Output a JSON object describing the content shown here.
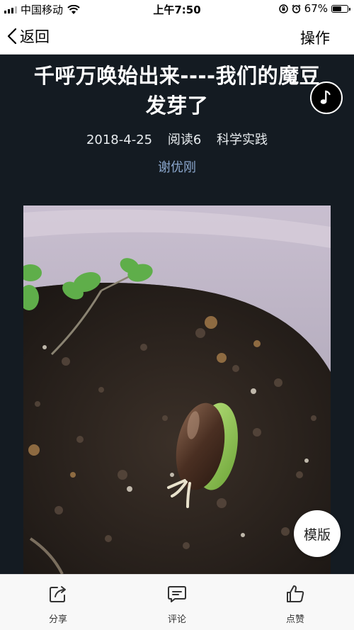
{
  "status_bar": {
    "carrier": "中国移动",
    "time": "上午7:50",
    "battery_percent": "67%",
    "battery_level": 0.67
  },
  "nav": {
    "back_label": "返回",
    "action_label": "操作"
  },
  "article": {
    "title_line1": "千呼万唤始出来----我们的魔豆",
    "title_line2": "发芽了",
    "date": "2018-4-25",
    "reads": "阅读6",
    "category": "科学实践",
    "author": "谢优刚"
  },
  "template_button_label": "模版",
  "bottom_bar": {
    "share_label": "分享",
    "comment_label": "评论",
    "like_label": "点赞"
  },
  "icons": {
    "back": "chevron-left-icon",
    "music": "music-note-icon",
    "share": "share-icon",
    "comment": "comment-icon",
    "like": "thumbs-up-icon"
  },
  "colors": {
    "page_background": "#141b22",
    "author_link": "#8aa6cc"
  }
}
